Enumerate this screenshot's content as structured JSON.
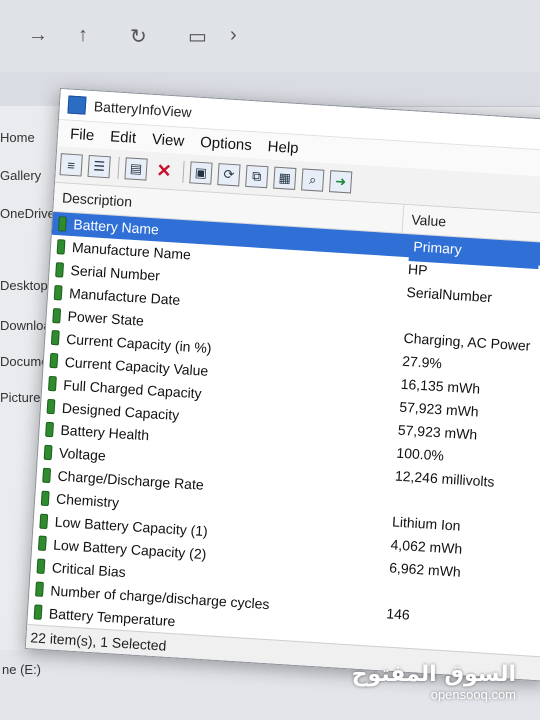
{
  "window": {
    "title": "BatteryInfoView"
  },
  "menu": [
    "File",
    "Edit",
    "View",
    "Options",
    "Help"
  ],
  "toolbar_icons": [
    "html-report-icon",
    "text-report-icon",
    "properties-icon",
    "delete-icon",
    "save-icon",
    "refresh-icon",
    "copy-icon",
    "options-icon",
    "search-icon",
    "exit-icon"
  ],
  "columns": {
    "description": "Description",
    "value": "Value"
  },
  "rows": [
    "Battery Name",
    "Manufacture Name",
    "Serial Number",
    "Manufacture Date",
    "Power State",
    "Current Capacity (in %)",
    "Current Capacity Value",
    "Full Charged Capacity",
    "Designed Capacity",
    "Battery Health",
    "Voltage",
    "Charge/Discharge Rate",
    "Chemistry",
    "Low Battery Capacity (1)",
    "Low Battery Capacity (2)",
    "Critical Bias",
    "Number of charge/discharge cycles",
    "Battery Temperature"
  ],
  "values": [
    "Primary",
    "HP",
    "SerialNumber",
    "",
    "Charging, AC Power",
    "27.9%",
    "16,135 mWh",
    "57,923 mWh",
    "57,923 mWh",
    "100.0%",
    "12,246 millivolts",
    "",
    "Lithium Ion",
    "4,062 mWh",
    "6,962 mWh",
    "",
    "146"
  ],
  "selected_row": 0,
  "status": "22 item(s), 1 Selected",
  "background": {
    "sidebar": [
      "Home",
      "Gallery",
      "OneDrive",
      "Desktop",
      "Downloads",
      "Documents",
      "Pictures"
    ],
    "drive": "ne (E:)"
  },
  "watermark": {
    "arabic": "السوق المفتوح",
    "latin": "opensooq.com"
  },
  "colors": {
    "selection": "#2f6fd6",
    "battery_icon": "#2e8b2e"
  }
}
